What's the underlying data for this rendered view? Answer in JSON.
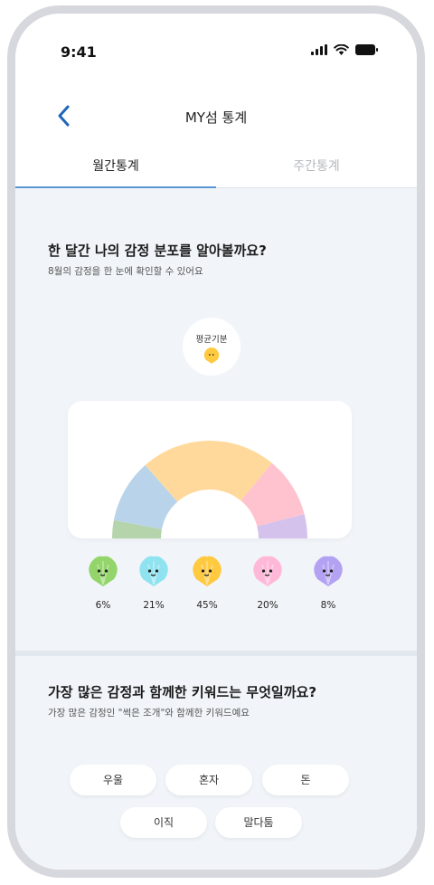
{
  "status_bar": {
    "time": "9:41"
  },
  "header": {
    "title": "MY섬 통계"
  },
  "tabs": [
    {
      "label": "월간통계",
      "active": true
    },
    {
      "label": "주간통계",
      "active": false
    }
  ],
  "distribution": {
    "heading": "한 달간 나의 감정 분포를 알아볼까요?",
    "subheading": "8월의 감정을 한 눈에 확인할 수 있어요",
    "average_label": "평균기분"
  },
  "chart_data": {
    "type": "pie",
    "categories": [
      "green",
      "blue",
      "yellow",
      "pink",
      "purple"
    ],
    "values": [
      6,
      21,
      45,
      20,
      8
    ],
    "labels": [
      "6%",
      "21%",
      "45%",
      "20%",
      "8%"
    ],
    "colors": [
      "#b5d4ab",
      "#b9d4ea",
      "#ffd99c",
      "#ffc3cf",
      "#d4c2ec"
    ]
  },
  "emotions": [
    {
      "icon": "green-shell-icon",
      "color": "#93d56a",
      "label": "6%"
    },
    {
      "icon": "blue-shell-icon",
      "color": "#8fe3f0",
      "label": "21%"
    },
    {
      "icon": "yellow-shell-icon",
      "color": "#ffc940",
      "label": "45%"
    },
    {
      "icon": "pink-shell-icon",
      "color": "#ffb8d8",
      "label": "20%"
    },
    {
      "icon": "purple-shell-icon",
      "color": "#b3a2f2",
      "label": "8%"
    }
  ],
  "keywords": {
    "heading": "가장 많은 감정과 함께한 키워드는 무엇일까요?",
    "subheading": "가장 많은 감정인 \"썩은 조개\"와 함께한 키워드예요",
    "chips": [
      "우울",
      "혼자",
      "돈",
      "이직",
      "말다툼"
    ]
  }
}
